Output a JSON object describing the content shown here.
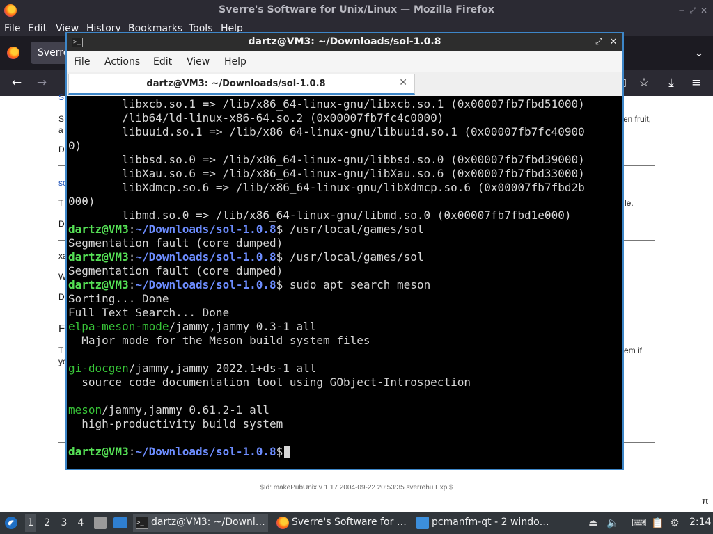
{
  "firefox": {
    "window_title": "Sverre's Software for Unix/Linux — Mozilla Firefox",
    "menu": [
      "File",
      "Edit",
      "View",
      "History",
      "Bookmarks",
      "Tools",
      "Help"
    ],
    "tab_label": "Sverre",
    "page": {
      "frag_s1": "S",
      "frag_s1_end": "en fruit,",
      "frag_a": "a",
      "frag_d1": "D",
      "frag_so": "so",
      "frag_t": "T",
      "frag_le": "le.",
      "frag_d2": "D",
      "frag_xa": "xa",
      "frag_w": "W",
      "frag_d3": "D",
      "frag_f": "F",
      "frag_t2": "T",
      "frag_em": "em if",
      "frag_yo": "yo",
      "footer": "$Id: makePubUnix,v 1.17 2004-09-22 20:53:35 sverrehu Exp $",
      "pi_symbol": "π"
    }
  },
  "terminal": {
    "window_title": "dartz@VM3: ~/Downloads/sol-1.0.8",
    "menu": [
      "File",
      "Actions",
      "Edit",
      "View",
      "Help"
    ],
    "tab_label": "dartz@VM3: ~/Downloads/sol-1.0.8",
    "prompt": {
      "user": "dartz@VM3",
      "colon": ":",
      "path": "~/Downloads/sol-1.0.8",
      "dollar": "$"
    },
    "lines": {
      "l01": "        libxcb.so.1 => /lib/x86_64-linux-gnu/libxcb.so.1 (0x00007fb7fbd51000)",
      "l02": "        /lib64/ld-linux-x86-64.so.2 (0x00007fb7fc4c0000)",
      "l03": "        libuuid.so.1 => /lib/x86_64-linux-gnu/libuuid.so.1 (0x00007fb7fc40900",
      "l04": "0)",
      "l05": "        libbsd.so.0 => /lib/x86_64-linux-gnu/libbsd.so.0 (0x00007fb7fbd39000)",
      "l06": "        libXau.so.6 => /lib/x86_64-linux-gnu/libXau.so.6 (0x00007fb7fbd33000)",
      "l07": "        libXdmcp.so.6 => /lib/x86_64-linux-gnu/libXdmcp.so.6 (0x00007fb7fbd2b",
      "l08": "000)",
      "l09": "        libmd.so.0 => /lib/x86_64-linux-gnu/libmd.so.0 (0x00007fb7fbd1e000)",
      "cmd1": " /usr/local/games/sol",
      "out1": "Segmentation fault (core dumped)",
      "cmd2": " /usr/local/games/sol",
      "out2": "Segmentation fault (core dumped)",
      "cmd3": " sudo apt search meson",
      "sorting": "Sorting... Done",
      "fts": "Full Text Search... Done",
      "pkg1_name": "elpa-meson-mode",
      "pkg1_ver": "/jammy,jammy 0.3-1 all",
      "pkg1_desc": "  Major mode for the Meson build system files",
      "pkg2_name": "gi-docgen",
      "pkg2_ver": "/jammy,jammy 2022.1+ds-1 all",
      "pkg2_desc": "  source code documentation tool using GObject-Introspection",
      "pkg3_name": "meson",
      "pkg3_ver": "/jammy,jammy 0.61.2-1 all",
      "pkg3_desc": "  high-productivity build system"
    }
  },
  "taskbar": {
    "workspaces": [
      "1",
      "2",
      "3",
      "4"
    ],
    "tasks": [
      {
        "label": "dartz@VM3: ~/Downl…"
      },
      {
        "label": "Sverre's Software for …"
      },
      {
        "label": "pcmanfm-qt - 2 windo…"
      }
    ],
    "clock": "2:14"
  }
}
